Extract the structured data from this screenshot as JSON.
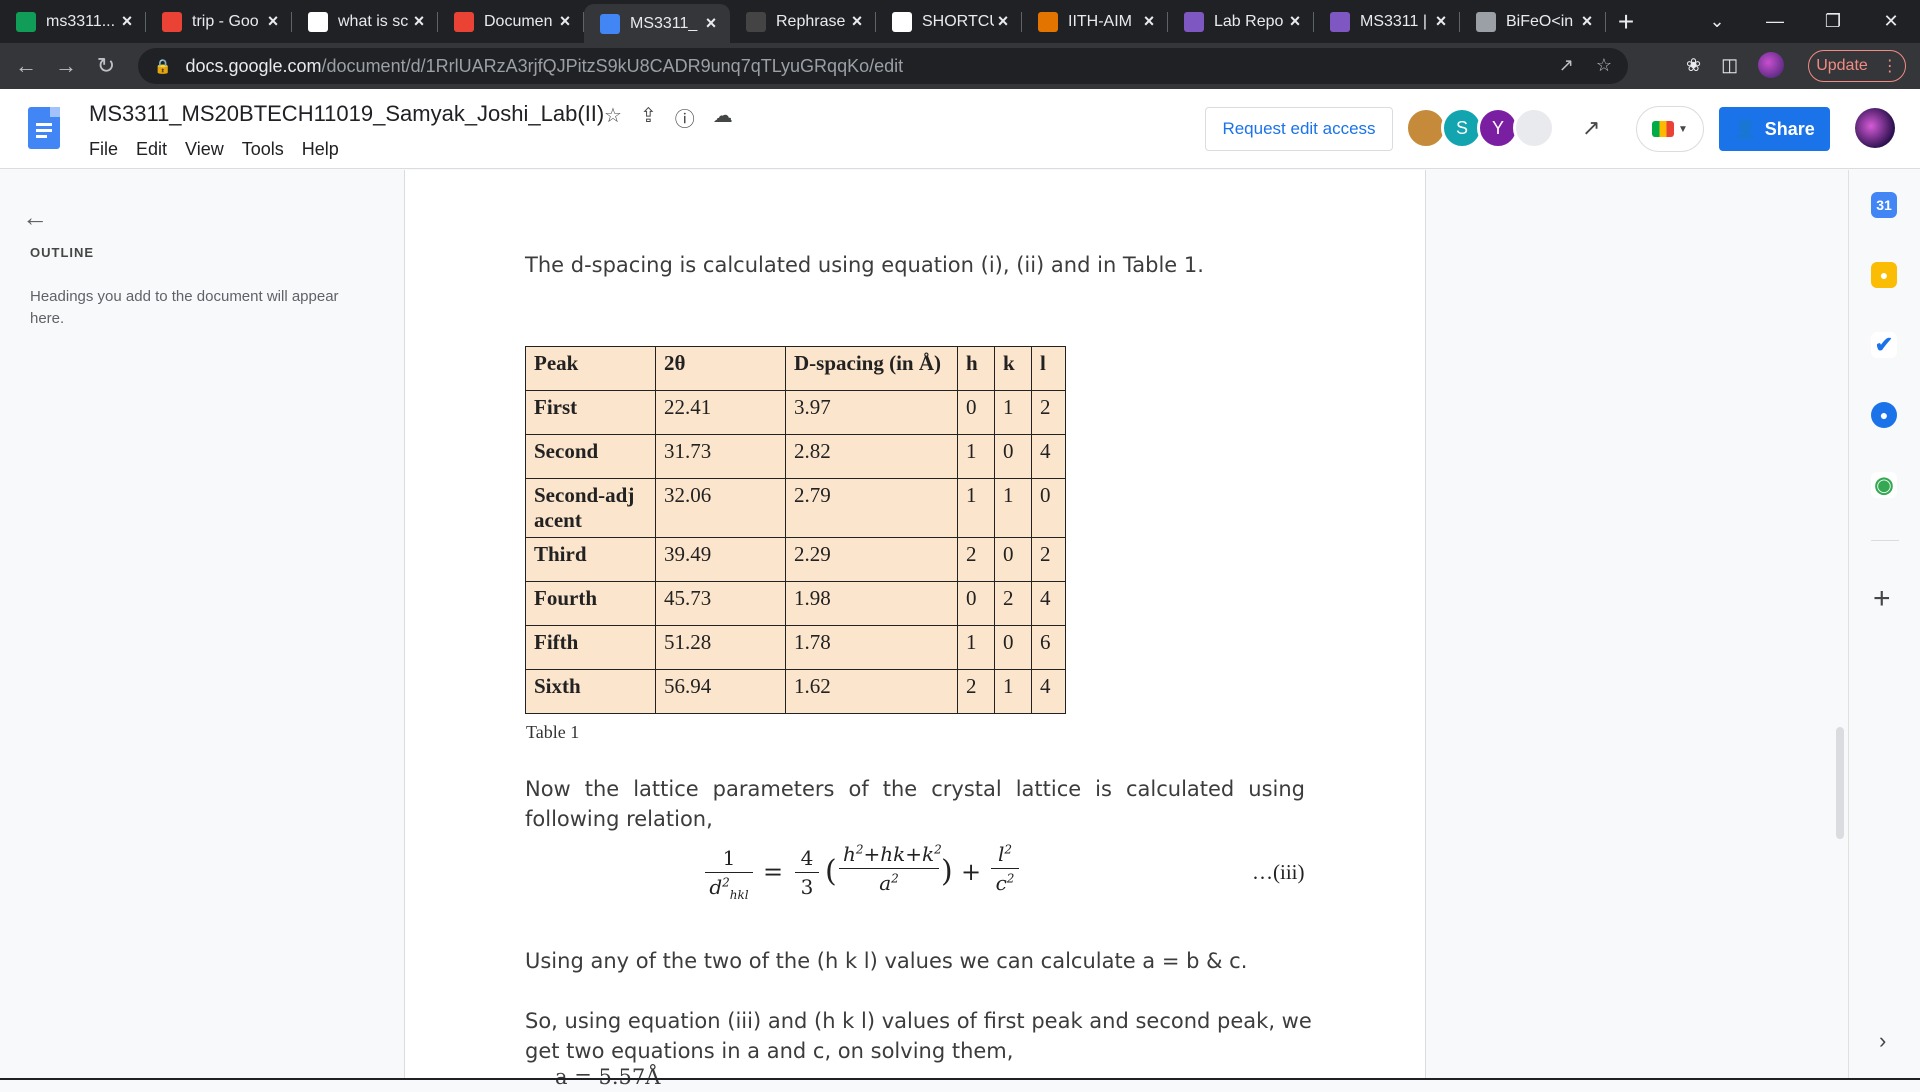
{
  "browser": {
    "tabs": [
      {
        "title": "ms3311...",
        "icon": "sheets-icon",
        "color": "#0f9d58"
      },
      {
        "title": "trip - Goo",
        "icon": "pinwheel-icon",
        "color": "#ea4335"
      },
      {
        "title": "what is sc",
        "icon": "google-icon",
        "color": "#ffffff"
      },
      {
        "title": "Documen",
        "icon": "gmail-icon",
        "color": "#ea4335"
      },
      {
        "title": "MS3311_",
        "icon": "docs-icon",
        "color": "#4285f4",
        "active": true
      },
      {
        "title": "Rephrase",
        "icon": "quillbot-icon",
        "color": "#444444"
      },
      {
        "title": "SHORTCU",
        "icon": "google-icon",
        "color": "#ffffff"
      },
      {
        "title": "IITH-AIM",
        "icon": "gift-icon",
        "color": "#e37400"
      },
      {
        "title": "Lab Repo",
        "icon": "classroom-icon",
        "color": "#7e57c2"
      },
      {
        "title": "MS3311 |",
        "icon": "classroom-icon",
        "color": "#7e57c2"
      },
      {
        "title": "BiFeO<in",
        "icon": "globe-icon",
        "color": "#9aa0a6"
      }
    ],
    "url_host": "docs.google.com",
    "url_path": "/document/d/1RrlUARzA3rjfQJPitzS9kU8CADR9unq7qTLyuGRqqKo/edit",
    "update_label": "Update"
  },
  "docs": {
    "title": "MS3311_MS20BTECH11019_Samyak_Joshi_Lab(II)",
    "menu": [
      "File",
      "Edit",
      "View",
      "Tools",
      "Help"
    ],
    "request_edit_label": "Request edit access",
    "share_label": "Share",
    "collaborators": [
      {
        "initial": "",
        "color": "#c58a3a"
      },
      {
        "initial": "S",
        "color": "#12a4af"
      },
      {
        "initial": "Y",
        "color": "#7b1fa2"
      },
      {
        "initial": "",
        "color": "#e8eaed"
      }
    ]
  },
  "outline": {
    "label": "OUTLINE",
    "hint": "Headings you add to the document will appear here."
  },
  "content": {
    "para1": "The d-spacing is calculated using equation (i), (ii) and  in Table 1.",
    "table": {
      "headers": [
        "Peak",
        "2θ",
        "D-spacing (in Å)",
        "h",
        "k",
        "l"
      ],
      "rows": [
        [
          "First",
          "22.41",
          "3.97",
          "0",
          "1",
          "2"
        ],
        [
          "Second",
          "31.73",
          "2.82",
          "1",
          "0",
          "4"
        ],
        [
          "Second-adj acent",
          "32.06",
          "2.79",
          "1",
          "1",
          "0"
        ],
        [
          "Third",
          "39.49",
          "2.29",
          "2",
          "0",
          "2"
        ],
        [
          "Fourth",
          "45.73",
          "1.98",
          "0",
          "2",
          "4"
        ],
        [
          "Fifth",
          "51.28",
          "1.78",
          "1",
          "0",
          "6"
        ],
        [
          "Sixth",
          "56.94",
          "1.62",
          "2",
          "1",
          "4"
        ]
      ]
    },
    "caption": "Table 1",
    "para2": "Now the lattice parameters of the crystal lattice is calculated using following relation,",
    "equation_number": "…(iii)",
    "para3": "Using any of the two of the (h k l) values we can calculate a = b & c.",
    "para4": "So, using equation (iii) and (h k l) values of first peak and second peak, we get two equations in a and c, on solving them,",
    "para5": "a = 5.57Å"
  }
}
